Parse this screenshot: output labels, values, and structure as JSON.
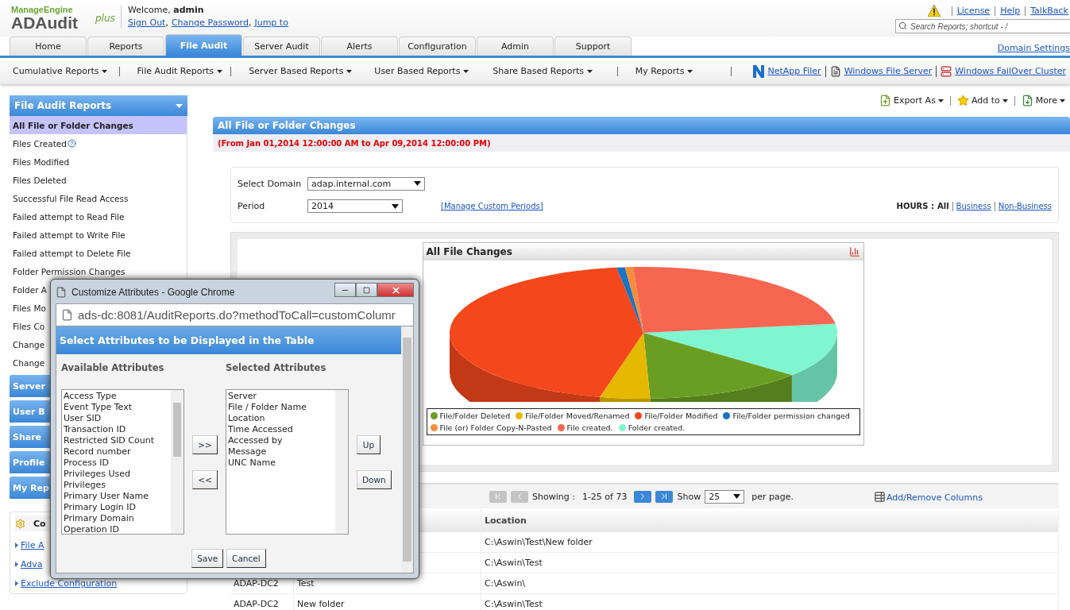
{
  "logo": {
    "brand": "ManageEngine",
    "product": "ADAudit",
    "edition": "plus"
  },
  "welcome": "Welcome, **admin**",
  "user_links": [
    "Sign Out",
    "Change Password",
    "Jump to"
  ],
  "link_separator": ",",
  "top_links": [
    "License",
    "Help",
    "TalkBack"
  ],
  "search": {
    "placeholder": "Search Reports; shortcut - /"
  },
  "tabs": [
    {
      "label": "Home",
      "selected": false
    },
    {
      "label": "Reports",
      "selected": false
    },
    {
      "label": "File Audit",
      "selected": true
    },
    {
      "label": "Server Audit",
      "selected": false
    },
    {
      "label": "Alerts",
      "selected": false
    },
    {
      "label": "Configuration",
      "selected": false
    },
    {
      "label": "Admin",
      "selected": false
    },
    {
      "label": "Support",
      "selected": false
    }
  ],
  "domain_settings": "Domain Settings",
  "subnav": [
    "Cumulative Reports",
    "File Audit Reports",
    "Server Based Reports",
    "User Based Reports",
    "Share Based Reports",
    "My Reports"
  ],
  "server_links": [
    {
      "label": "NetApp Filer",
      "kind": "netapp"
    },
    {
      "label": "Windows File Server",
      "kind": "fileserver"
    },
    {
      "label": "Windows FailOver Cluster",
      "kind": "cluster"
    }
  ],
  "sidebar": {
    "title": "File Audit Reports",
    "items": [
      {
        "label": "All File or Folder Changes",
        "selected": true,
        "help": false
      },
      {
        "label": "Files Created",
        "selected": false,
        "help": true
      },
      {
        "label": "Files Modified",
        "selected": false,
        "help": false
      },
      {
        "label": "Files Deleted",
        "selected": false,
        "help": false
      },
      {
        "label": "Successful File Read Access",
        "selected": false,
        "help": false
      },
      {
        "label": "Failed attempt to Read File",
        "selected": false,
        "help": false
      },
      {
        "label": "Failed attempt to Write File",
        "selected": false,
        "help": false
      },
      {
        "label": "Failed attempt to Delete File",
        "selected": false,
        "help": false
      },
      {
        "label": "Folder Permission Changes",
        "selected": false,
        "help": false
      },
      {
        "label": "Folder A",
        "selected": false,
        "help": false
      },
      {
        "label": "Files Mo",
        "selected": false,
        "help": false
      },
      {
        "label": "Files Co",
        "selected": false,
        "help": false
      },
      {
        "label": "Change",
        "selected": false,
        "help": false
      },
      {
        "label": "Change",
        "selected": false,
        "help": false
      }
    ],
    "sections": [
      "Server",
      "User B",
      "Share",
      "Profile",
      "My Rep"
    ],
    "config": {
      "title": "Co",
      "links": [
        "File A",
        "Adva",
        "Exclude Configuration"
      ]
    }
  },
  "actions": [
    "Export As",
    "Add to",
    "More"
  ],
  "report": {
    "title": "All File or Folder Changes",
    "range": "(From Jan 01,2014 12:00:00 AM to Apr 09,2014 12:00:00 PM)",
    "domain_label": "Select Domain",
    "domain": "adap.internal.com",
    "period_label": "Period",
    "period": "2014",
    "custom_periods": "[Manage Custom Periods]",
    "hours_label": "HOURS :",
    "hours": [
      {
        "label": "All",
        "selected": true
      },
      {
        "label": "Business",
        "selected": false
      },
      {
        "label": "Non-Business",
        "selected": false
      }
    ]
  },
  "chart": {
    "title": "All File Changes",
    "legend": [
      {
        "label": "File/Folder Deleted",
        "color": "#6a9e23"
      },
      {
        "label": "File/Folder Moved/Renamed",
        "color": "#e5b900"
      },
      {
        "label": "File/Folder Modified",
        "color": "#f4471b"
      },
      {
        "label": "File/Folder permission changed",
        "color": "#1a73c3"
      },
      {
        "label": "File (or) Folder Copy-N-Pasted",
        "color": "#f58d3a"
      },
      {
        "label": "File created.",
        "color": "#f76650"
      },
      {
        "label": "Folder created.",
        "color": "#7ff5d0"
      }
    ]
  },
  "pagination": {
    "buttons": [
      {
        "kind": "first",
        "disabled": true
      },
      {
        "kind": "prev",
        "disabled": true
      },
      {
        "kind": "next",
        "disabled": false
      },
      {
        "kind": "last",
        "disabled": false
      }
    ],
    "showing_label": "Showing :",
    "range": "1-25 of 73",
    "show_label": "Show",
    "per_page": "25",
    "per_page_suffix": "per page.",
    "columns_link": "Add/Remove Columns"
  },
  "table": {
    "columns": [
      {
        "label": "Location"
      }
    ],
    "rows": [
      {
        "location": "C:\\Aswin\\Test\\New folder"
      },
      {
        "location": "C:\\Aswin\\Test"
      },
      {
        "server": "ADAP-DC2",
        "name": "Test",
        "location": "C:\\Aswin\\"
      },
      {
        "server": "ADAP-DC2",
        "name": "New folder",
        "location": "C:\\Aswin\\Test"
      }
    ]
  },
  "popup": {
    "title": "Customize Attributes - Google Chrome",
    "url": "ads-dc:8081/AuditReports.do?methodToCall=customColumr",
    "heading": "Select Attributes to be Displayed in the Table",
    "available_label": "Available Attributes",
    "selected_label": "Selected Attributes",
    "available": [
      "Access Type",
      "Event Type Text",
      "User SID",
      "Transaction ID",
      "Restricted SID Count",
      "Record number",
      "Process ID",
      "Privileges Used",
      "Privileges",
      "Primary User Name",
      "Primary Login ID",
      "Primary Domain",
      "Operation ID"
    ],
    "selected": [
      "Server",
      "File / Folder Name",
      "Location",
      "Time Accessed",
      "Accessed by",
      "Message",
      "UNC Name"
    ],
    "add_button": ">>",
    "remove_button": "<<",
    "up_button": "Up",
    "down_button": "Down",
    "save_button": "Save",
    "cancel_button": "Cancel"
  }
}
